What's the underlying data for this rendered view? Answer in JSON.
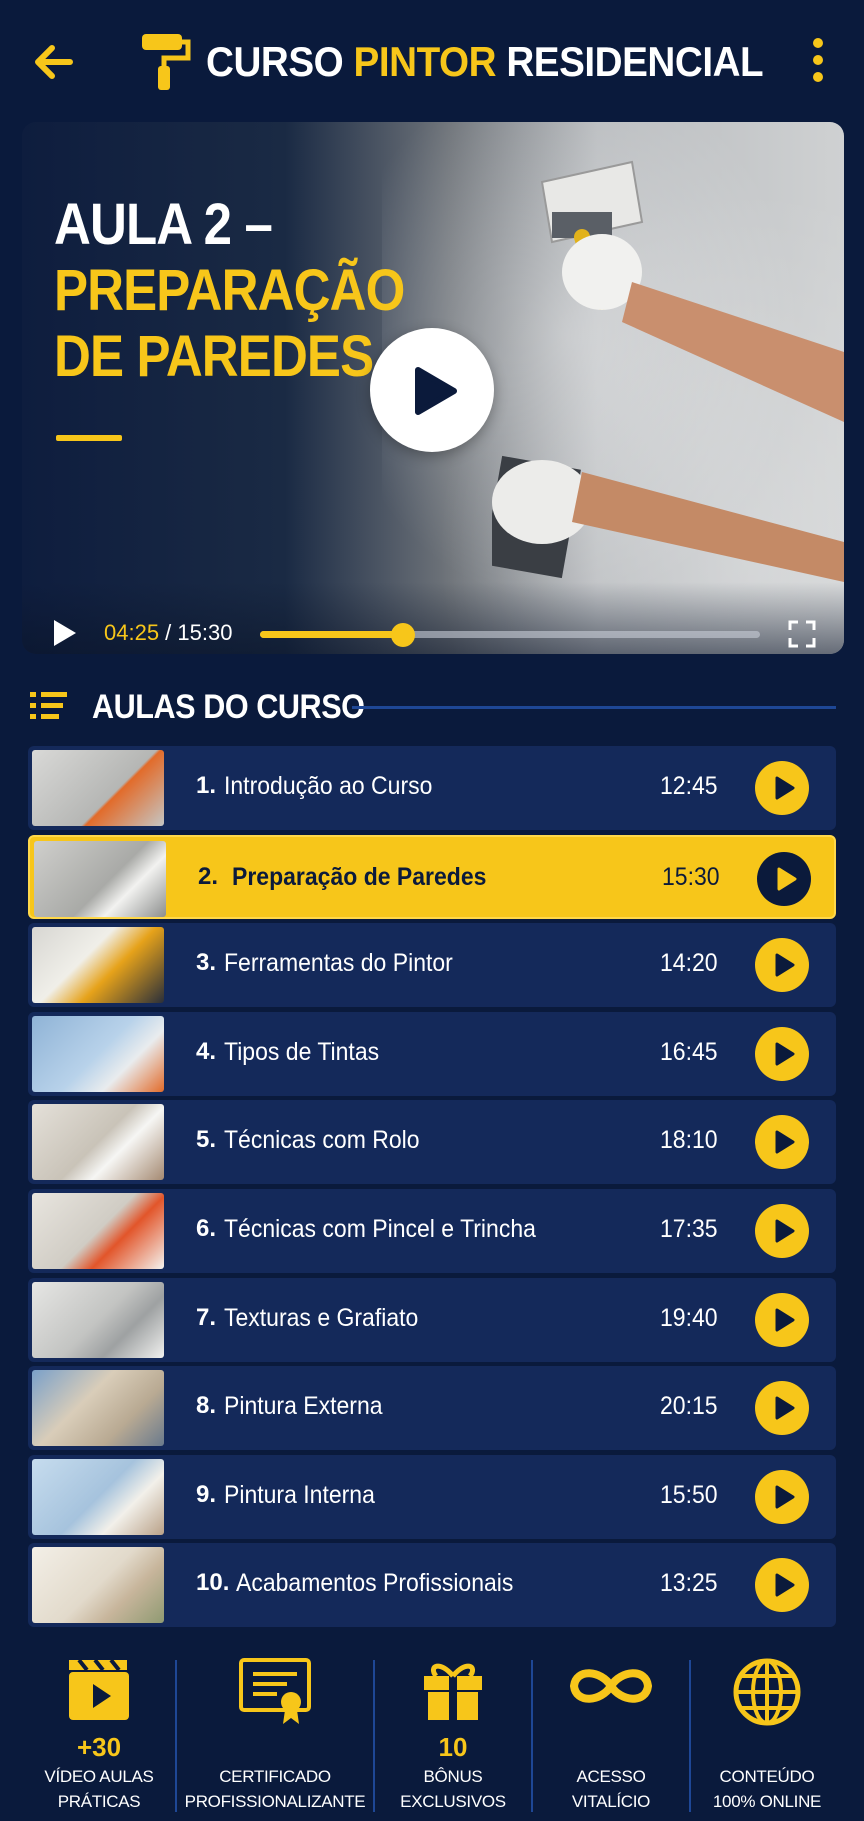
{
  "header": {
    "title_part1": "CURSO ",
    "title_highlight": "PINTOR",
    "title_part2": " RESIDENCIAL",
    "back_icon": "arrow-left-icon",
    "menu_icon": "kebab-menu-icon",
    "logo_icon": "paint-roller-icon"
  },
  "player": {
    "title_line1": "AULA 2 –",
    "title_line2": "PREPARAÇÃO",
    "title_line3": "DE PAREDES",
    "current_time": "04:25",
    "separator": " / ",
    "total_time": "15:30",
    "progress": 0.285
  },
  "section": {
    "title": "AULAS DO CURSO",
    "icon": "list-icon"
  },
  "lessons": [
    {
      "num": "1.",
      "title": "Introdução ao Curso",
      "duration": "12:45"
    },
    {
      "num": "2.",
      "title": "Preparação de Paredes",
      "duration": "15:30",
      "active": true
    },
    {
      "num": "3.",
      "title": "Ferramentas do Pintor",
      "duration": "14:20"
    },
    {
      "num": "4.",
      "title": "Tipos de Tintas",
      "duration": "16:45"
    },
    {
      "num": "5.",
      "title": "Técnicas com Rolo",
      "duration": "18:10"
    },
    {
      "num": "6.",
      "title": "Técnicas com Pincel e Trincha",
      "duration": "17:35"
    },
    {
      "num": "7.",
      "title": "Texturas e Grafiato",
      "duration": "19:40"
    },
    {
      "num": "8.",
      "title": "Pintura Externa",
      "duration": "20:15"
    },
    {
      "num": "9.",
      "title": "Pintura Interna",
      "duration": "15:50"
    },
    {
      "num": "10.",
      "title": "Acabamentos Profissionais",
      "duration": "13:25"
    }
  ],
  "features": [
    {
      "big": "+30",
      "line1": "VÍDEO AULAS",
      "line2": "PRÁTICAS",
      "icon": "clapperboard-icon"
    },
    {
      "big": "",
      "line1": "CERTIFICADO",
      "line2": "PROFISSIONALIZANTE",
      "icon": "certificate-icon"
    },
    {
      "big": "10",
      "line1": "BÔNUS",
      "line2": "EXCLUSIVOS",
      "icon": "gift-icon"
    },
    {
      "big": "",
      "line1": "ACESSO",
      "line2": "VITALÍCIO",
      "icon": "infinity-icon"
    },
    {
      "big": "",
      "line1": "CONTEÚDO",
      "line2": "100% ONLINE",
      "icon": "globe-icon"
    }
  ],
  "colors": {
    "background": "#0a1a3c",
    "accent": "#f7c61a",
    "row": "#14295a",
    "divider": "#1e4796"
  }
}
